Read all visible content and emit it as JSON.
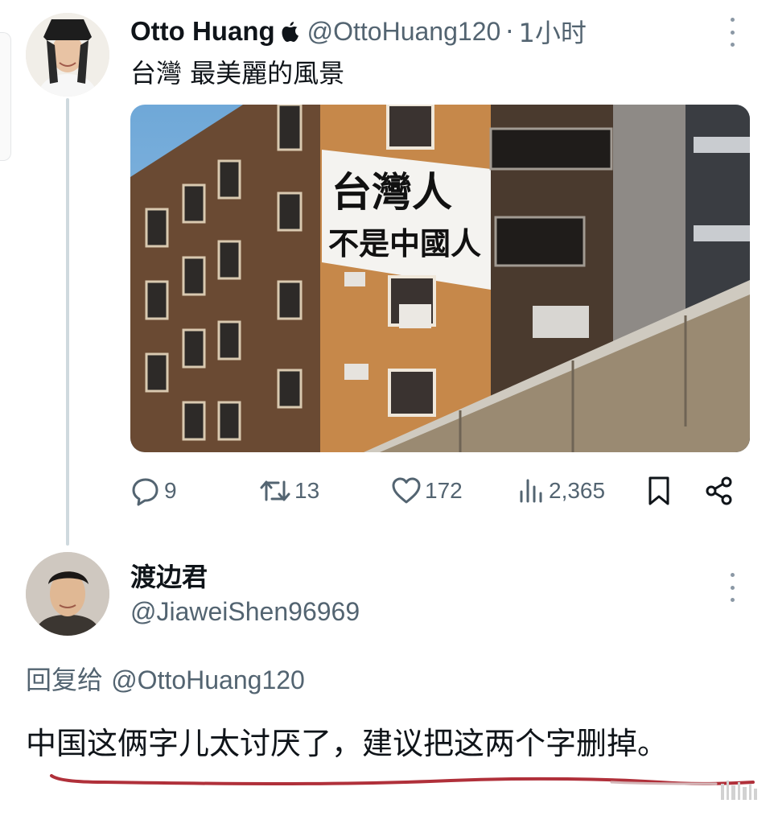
{
  "tweet": {
    "author_name": "Otto Huang",
    "author_handle": "@OttoHuang120",
    "separator": "·",
    "time": "1小时",
    "text": "台灣 最美麗的風景",
    "media": {
      "banner_line1": "台灣人",
      "banner_line2": "不是中國人"
    },
    "stats": {
      "replies": "9",
      "retweets": "13",
      "likes": "172",
      "views": "2,365"
    }
  },
  "reply": {
    "author_name": "渡边君",
    "author_handle": "@JiaweiShen96969",
    "replying_to_label": "回复给",
    "replying_to_handle": "@OttoHuang120",
    "text": "中国这俩字儿太讨厌了，建议把这两个字删掉。"
  },
  "icons": {
    "verified": "apple-icon",
    "more": "more-icon",
    "reply": "reply-icon",
    "retweet": "retweet-icon",
    "like": "heart-icon",
    "views": "views-icon",
    "bookmark": "bookmark-icon",
    "share": "share-icon"
  },
  "colors": {
    "text_primary": "#0f1419",
    "text_secondary": "#536471",
    "thread_line": "#cfd9de",
    "underline": "#b0303a"
  }
}
